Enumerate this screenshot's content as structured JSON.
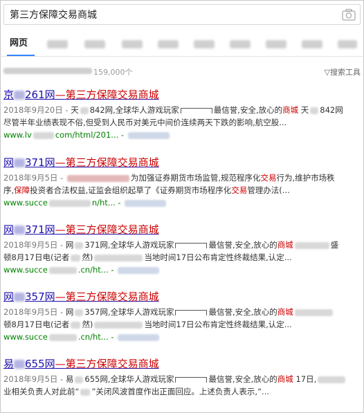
{
  "search": {
    "query": "第三方保障交易商城"
  },
  "tabs": {
    "active_label": "网页"
  },
  "results_count": "159,000个",
  "search_tools_label": "▽搜索工具",
  "results": [
    {
      "title_pre": "京",
      "title_num": "261网",
      "title_sep": "—",
      "title_main": "第三方保障交易商城",
      "date": "2018年9月20日 - ",
      "desc1_a": "天",
      "desc1_b": "842网,全球华人游戏玩家",
      "desc1_c": "最信誉,安全,放心的",
      "desc1_hl": "商城",
      "desc1_d": "天",
      "desc1_e": "842网",
      "desc2": "尽管半年业绩表现不俗,但受到人民币对美元中间价连续两天下跌的影响,航空股...",
      "url_a": "www.lv",
      "url_b": "com/html/201...",
      "url_c": "-"
    },
    {
      "title_pre": "网",
      "title_num": "371网",
      "title_sep": "—",
      "title_main": "第三方保障交易商城",
      "date": "2018年9月5日 - ",
      "desc1_c": "为加强证券期货市场监管,规范程序化",
      "desc1_hl": "交易",
      "desc1_d": "行为,维护市场秩",
      "desc2_a": "序,",
      "desc2_hl": "保障",
      "desc2_b": "投资者合法权益,证监会组织起草了《证券期货市场程序化",
      "desc2_hl2": "交易",
      "desc2_c": "管理办法(...",
      "url_a": "www.succe",
      "url_b": "n/ht...",
      "url_c": "-"
    },
    {
      "title_pre": "网",
      "title_num": "371网",
      "title_sep": "—",
      "title_main": "第三方保障交易商城",
      "date": "2018年9月5日 - ",
      "desc1_a": "网",
      "desc1_b": "371网,全球华人游戏玩家",
      "desc1_c": "最信誉,安全,放心的",
      "desc1_hl": "商城",
      "desc1_d": "盛",
      "desc2_a": "顿8月17日电(记者",
      "desc2_b": "然)",
      "desc2_c": "当地时间17日公布肯定性终裁结果,认定...",
      "url_a": "www.succe",
      "url_b": ".cn/ht...",
      "url_c": "-"
    },
    {
      "title_pre": "网",
      "title_num": "357网",
      "title_sep": "—",
      "title_main": "第三方保障交易商城",
      "date": "2018年9月5日 - ",
      "desc1_a": "网",
      "desc1_b": "357网,全球华人游戏玩家",
      "desc1_c": "最信誉,安全,放心的",
      "desc1_hl": "商城",
      "desc1_d": "",
      "desc2_a": "顿8月17日电(记者",
      "desc2_b": "然)",
      "desc2_c": "当地时间17日公布肯定性终裁结果,认定...",
      "url_a": "www.succe",
      "url_b": ".cn/ht...",
      "url_c": "-"
    },
    {
      "title_pre": "易",
      "title_num": "655网",
      "title_sep": "—",
      "title_main": "第三方保障交易商城",
      "date": "2018年9月5日 - ",
      "desc1_a": "易",
      "desc1_b": "655网,全球华人游戏玩家",
      "desc1_c": "最信誉,安全,放心的",
      "desc1_hl": "商城",
      "desc1_d": "17日,",
      "desc2_a": "业相关负责人对此前“",
      "desc2_b": "”关闭风波首度作出正面回应。上述负责人表示,“...",
      "url_a": "www.succe",
      "url_b": ".cn/ht...",
      "url_c": "-"
    }
  ]
}
